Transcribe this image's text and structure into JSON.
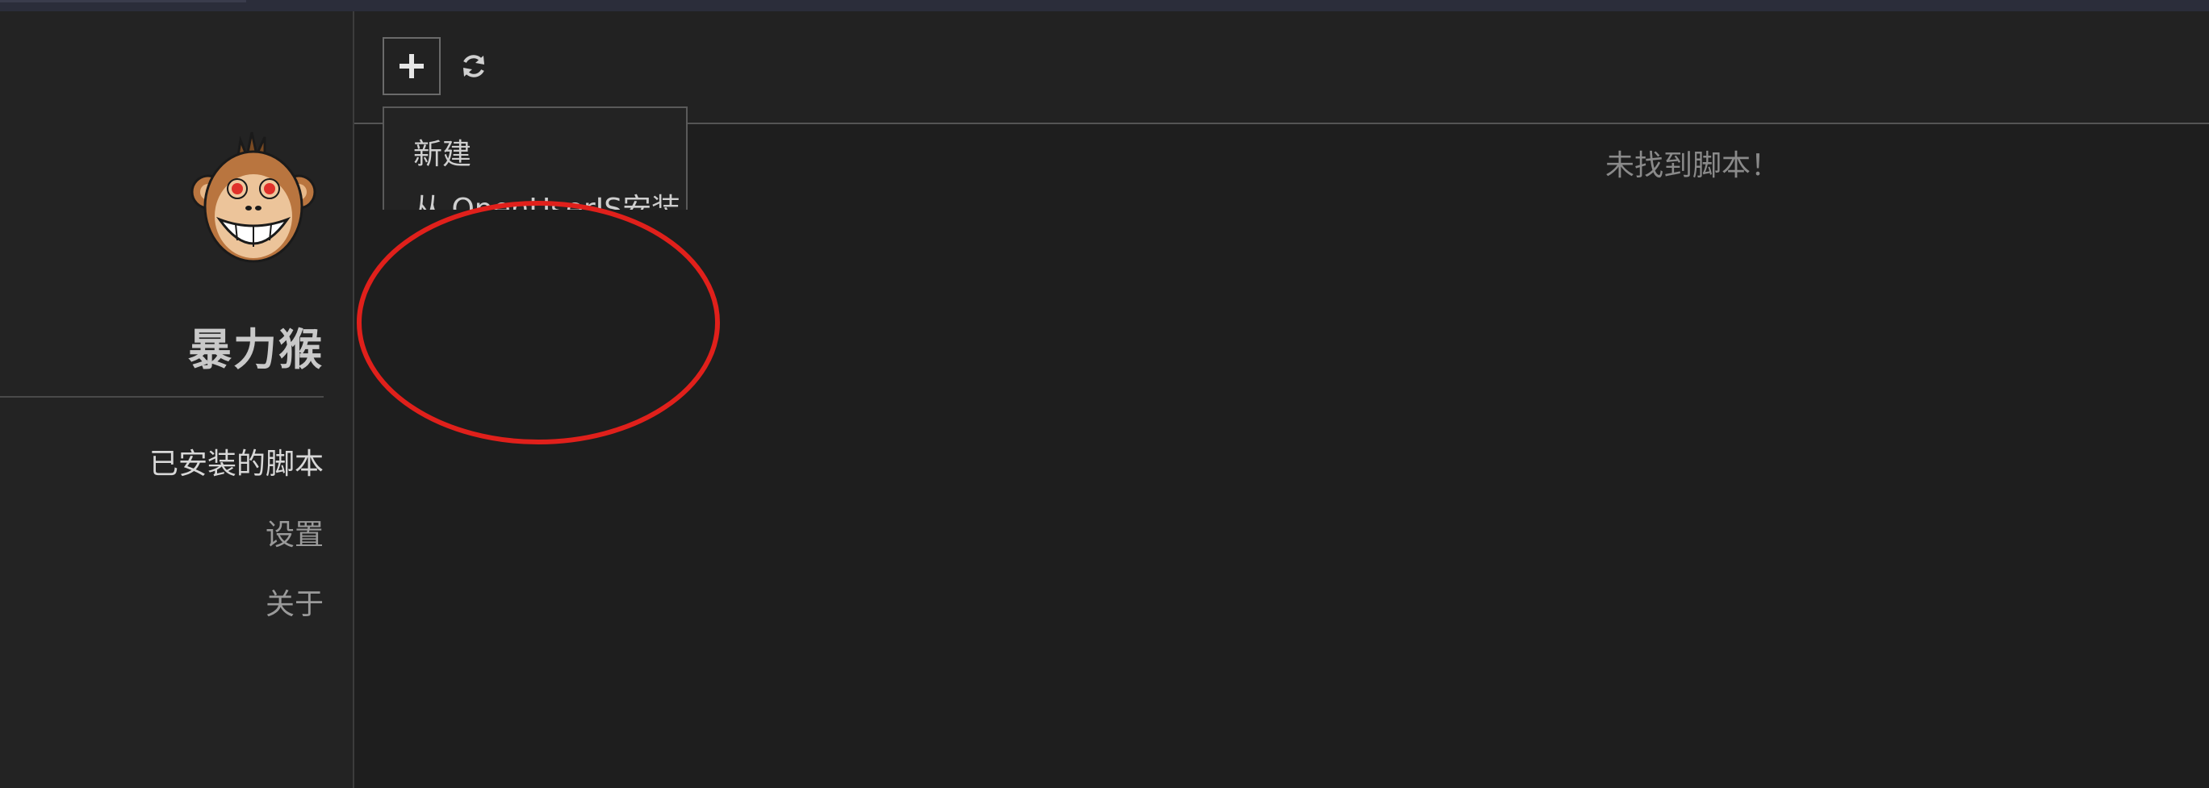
{
  "app": {
    "name": "暴力猴"
  },
  "sidebar": {
    "items": [
      {
        "label": "已安装的脚本",
        "active": true
      },
      {
        "label": "设置",
        "active": false
      },
      {
        "label": "关于",
        "active": false
      }
    ]
  },
  "toolbar": {
    "add_icon": "plus-icon",
    "refresh_icon": "refresh-icon"
  },
  "dropdown": {
    "items": [
      {
        "label": "新建"
      },
      {
        "label": "从 OpenUserJS安装"
      }
    ]
  },
  "main": {
    "empty_message": "未找到脚本！"
  },
  "colors": {
    "background": "#1e1e1e",
    "sidebar": "#232323",
    "annotation": "#e0201b"
  }
}
